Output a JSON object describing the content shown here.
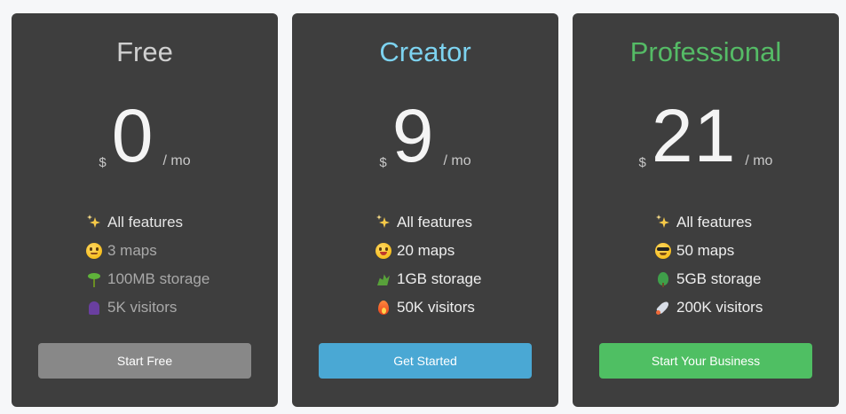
{
  "plans": [
    {
      "name": "Free",
      "accent": "#d0d0d0",
      "currency": "$",
      "price": "0",
      "period": "/ mo",
      "features": [
        {
          "icon": "sparkles-icon",
          "label": "All features"
        },
        {
          "icon": "grimacing-face-icon",
          "label": "3 maps"
        },
        {
          "icon": "seedling-icon",
          "label": "100MB storage"
        },
        {
          "icon": "ghost-icon",
          "label": "5K visitors"
        }
      ],
      "cta": "Start Free",
      "cta_color": "#888888"
    },
    {
      "name": "Creator",
      "accent": "#7dd3f0",
      "currency": "$",
      "price": "9",
      "period": "/ mo",
      "features": [
        {
          "icon": "sparkles-icon",
          "label": "All features"
        },
        {
          "icon": "grinning-face-icon",
          "label": "20 maps"
        },
        {
          "icon": "herb-icon",
          "label": "1GB storage"
        },
        {
          "icon": "fire-icon",
          "label": "50K visitors"
        }
      ],
      "cta": "Get Started",
      "cta_color": "#4aa8d4"
    },
    {
      "name": "Professional",
      "accent": "#55bb66",
      "currency": "$",
      "price": "21",
      "period": "/ mo",
      "features": [
        {
          "icon": "sparkles-icon",
          "label": "All features"
        },
        {
          "icon": "sunglasses-face-icon",
          "label": "50 maps"
        },
        {
          "icon": "tree-icon",
          "label": "5GB storage"
        },
        {
          "icon": "rocket-icon",
          "label": "200K visitors"
        }
      ],
      "cta": "Start Your Business",
      "cta_color": "#4fbf63"
    }
  ]
}
